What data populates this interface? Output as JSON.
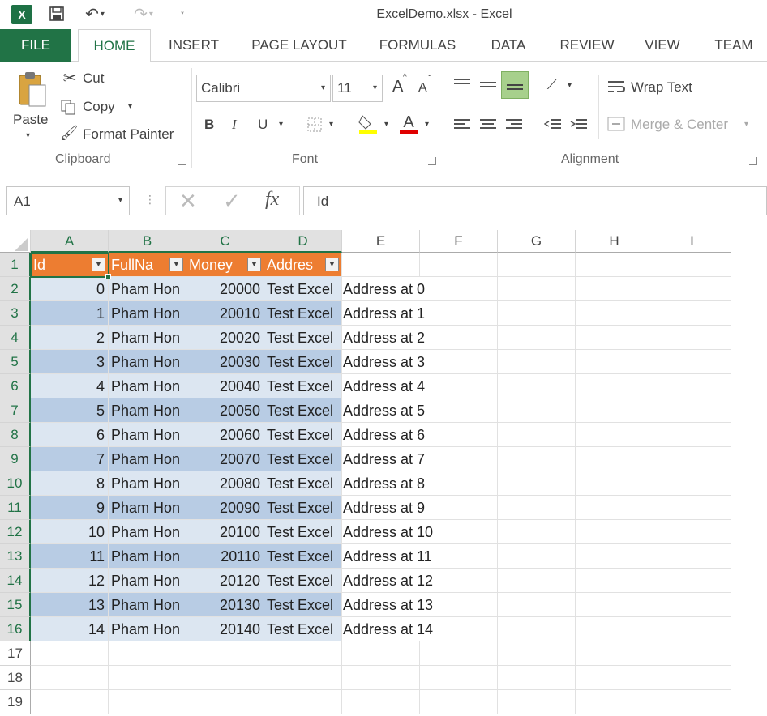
{
  "title_bar": {
    "app_icon": "X",
    "title": "ExcelDemo.xlsx - Excel"
  },
  "ribbon_tabs": [
    "FILE",
    "HOME",
    "INSERT",
    "PAGE LAYOUT",
    "FORMULAS",
    "DATA",
    "REVIEW",
    "VIEW",
    "TEAM"
  ],
  "ribbon": {
    "clipboard": {
      "paste": "Paste",
      "cut": "Cut",
      "copy": "Copy",
      "format_painter": "Format Painter",
      "label": "Clipboard"
    },
    "font": {
      "font_name": "Calibri",
      "font_size": "11",
      "bold": "B",
      "italic": "I",
      "underline": "U",
      "grow": "A",
      "shrink": "A",
      "font_color": "A",
      "label": "Font"
    },
    "alignment": {
      "wrap_text": "Wrap Text",
      "merge_center": "Merge & Center",
      "label": "Alignment"
    }
  },
  "formula_bar": {
    "name_box": "A1",
    "fx": "fx",
    "content": "Id"
  },
  "sheet": {
    "columns": [
      "A",
      "B",
      "C",
      "D",
      "E",
      "F",
      "G",
      "H",
      "I"
    ],
    "rows": [
      "1",
      "2",
      "3",
      "4",
      "5",
      "6",
      "7",
      "8",
      "9",
      "10",
      "11",
      "12",
      "13",
      "14",
      "15",
      "16",
      "17",
      "18",
      "19"
    ],
    "header_cells": [
      "Id",
      "FullNa",
      "Money",
      "Addres"
    ],
    "data": [
      {
        "id": "0",
        "name": "Pham Hon",
        "money": "20000",
        "addr": "Test Excel",
        "addr2": "Address at 0"
      },
      {
        "id": "1",
        "name": "Pham Hon",
        "money": "20010",
        "addr": "Test Excel",
        "addr2": "Address at 1"
      },
      {
        "id": "2",
        "name": "Pham Hon",
        "money": "20020",
        "addr": "Test Excel",
        "addr2": "Address at 2"
      },
      {
        "id": "3",
        "name": "Pham Hon",
        "money": "20030",
        "addr": "Test Excel",
        "addr2": "Address at 3"
      },
      {
        "id": "4",
        "name": "Pham Hon",
        "money": "20040",
        "addr": "Test Excel",
        "addr2": "Address at 4"
      },
      {
        "id": "5",
        "name": "Pham Hon",
        "money": "20050",
        "addr": "Test Excel",
        "addr2": "Address at 5"
      },
      {
        "id": "6",
        "name": "Pham Hon",
        "money": "20060",
        "addr": "Test Excel",
        "addr2": "Address at 6"
      },
      {
        "id": "7",
        "name": "Pham Hon",
        "money": "20070",
        "addr": "Test Excel",
        "addr2": "Address at 7"
      },
      {
        "id": "8",
        "name": "Pham Hon",
        "money": "20080",
        "addr": "Test Excel",
        "addr2": "Address at 8"
      },
      {
        "id": "9",
        "name": "Pham Hon",
        "money": "20090",
        "addr": "Test Excel",
        "addr2": "Address at 9"
      },
      {
        "id": "10",
        "name": "Pham Hon",
        "money": "20100",
        "addr": "Test Excel",
        "addr2": "Address at 10"
      },
      {
        "id": "11",
        "name": "Pham Hon",
        "money": "20110",
        "addr": "Test Excel",
        "addr2": "Address at 11"
      },
      {
        "id": "12",
        "name": "Pham Hon",
        "money": "20120",
        "addr": "Test Excel",
        "addr2": "Address at 12"
      },
      {
        "id": "13",
        "name": "Pham Hon",
        "money": "20130",
        "addr": "Test Excel",
        "addr2": "Address at 13"
      },
      {
        "id": "14",
        "name": "Pham Hon",
        "money": "20140",
        "addr": "Test Excel",
        "addr2": "Address at 14"
      }
    ]
  },
  "colors": {
    "excel_green": "#217346",
    "table_header": "#ed7d31",
    "band_light": "#dce6f1",
    "band_dark": "#b8cce4"
  }
}
